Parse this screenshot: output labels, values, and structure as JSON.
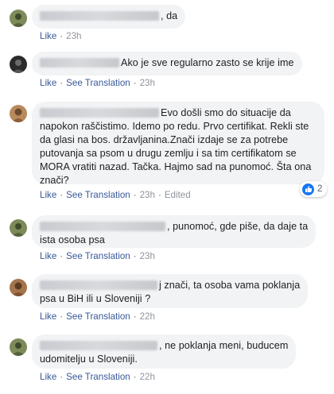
{
  "comments": [
    {
      "text": ", da",
      "like_label": "Like",
      "time": "23h"
    },
    {
      "text": "Ako je sve regularno zasto se krije ime",
      "like_label": "Like",
      "translate_label": "See Translation",
      "time": "23h"
    },
    {
      "line1": "Evo došli smo do situacije da",
      "rest": "napokon raščistimo. Idemo po redu. Prvo certifikat. Rekli ste\nda glasi na bos. državljanina.Znači izdaje se za potrebe\nputovanja sa psom u drugu zemlju i sa tim certifikatom se\nMORA vratiti nazad. Tačka. Hajmo sad na punomoć. Šta ona\nznači?",
      "like_label": "Like",
      "translate_label": "See Translation",
      "time": "23h",
      "edited_label": "Edited",
      "reaction_count": "2"
    },
    {
      "line1": ", punomoć, gde piše, da daje ta",
      "rest": "ista osoba psa",
      "like_label": "Like",
      "translate_label": "See Translation",
      "time": "23h"
    },
    {
      "line1": "j znači, ta osoba vama poklanja",
      "rest": "psa u BiH ili u Sloveniji ?",
      "like_label": "Like",
      "translate_label": "See Translation",
      "time": "22h"
    },
    {
      "line1": ", ne poklanja meni, buducem",
      "rest": "udomitelju u Sloveniji.",
      "like_label": "Like",
      "translate_label": "See Translation",
      "time": "22h"
    }
  ],
  "colors": {
    "bubble": "#f2f3f5",
    "link": "#385898",
    "meta": "#606770",
    "like_badge": "#1877f2"
  }
}
